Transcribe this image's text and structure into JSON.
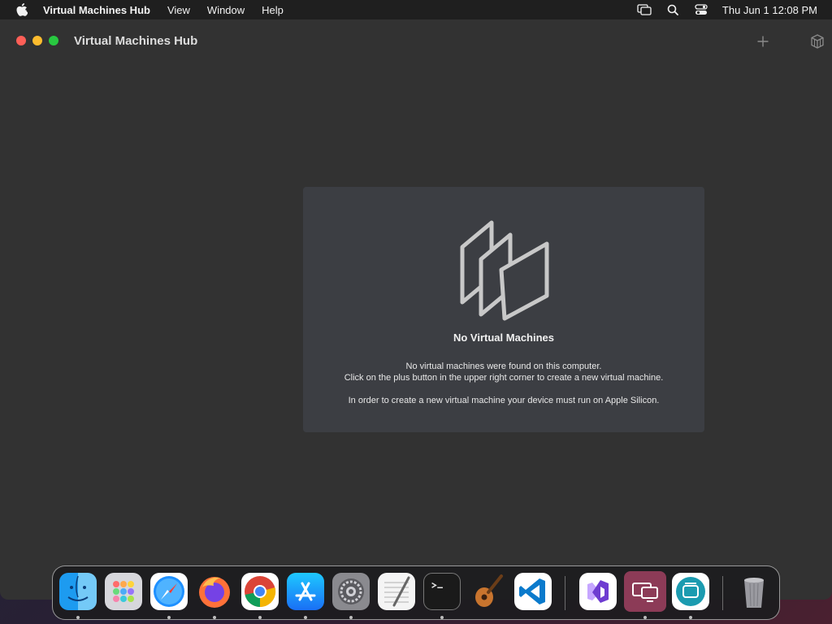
{
  "menubar": {
    "app_name": "Virtual Machines Hub",
    "items": [
      "View",
      "Window",
      "Help"
    ],
    "clock": "Thu Jun 1  12:08 PM",
    "icons": [
      "screen-mirroring-icon",
      "search-icon",
      "control-center-icon"
    ]
  },
  "window": {
    "title": "Virtual Machines Hub",
    "add_button_icon": "plus-icon",
    "toolbar_icon": "cube-icon"
  },
  "empty_state": {
    "icon": "stacked-pages-icon",
    "title": "No Virtual Machines",
    "line1": "No virtual machines were found on this computer.",
    "line2": "Click on the plus button in the upper right corner to create a new virtual machine.",
    "line3": "In order to create a new virtual machine your device must run on Apple Silicon."
  },
  "dock": {
    "apps": [
      {
        "name": "finder-icon",
        "running": true
      },
      {
        "name": "launchpad-icon",
        "running": false
      },
      {
        "name": "safari-icon",
        "running": true
      },
      {
        "name": "firefox-icon",
        "running": true
      },
      {
        "name": "chrome-icon",
        "running": true
      },
      {
        "name": "app-store-icon",
        "running": true
      },
      {
        "name": "system-settings-icon",
        "running": true
      },
      {
        "name": "textedit-icon",
        "running": false
      },
      {
        "name": "terminal-icon",
        "running": true
      },
      {
        "name": "garageband-icon",
        "running": false
      },
      {
        "name": "vscode-icon",
        "running": false
      },
      {
        "name": "visual-studio-icon",
        "running": false
      },
      {
        "name": "virtual-machines-hub-icon",
        "running": true
      },
      {
        "name": "layers-app-icon",
        "running": true
      },
      {
        "name": "trash-icon",
        "running": false
      }
    ]
  },
  "colors": {
    "window_bg": "#323232",
    "panel_bg": "#3c3e43",
    "close": "#fe5f57",
    "minimize": "#febc2e",
    "maximize": "#28c840"
  }
}
